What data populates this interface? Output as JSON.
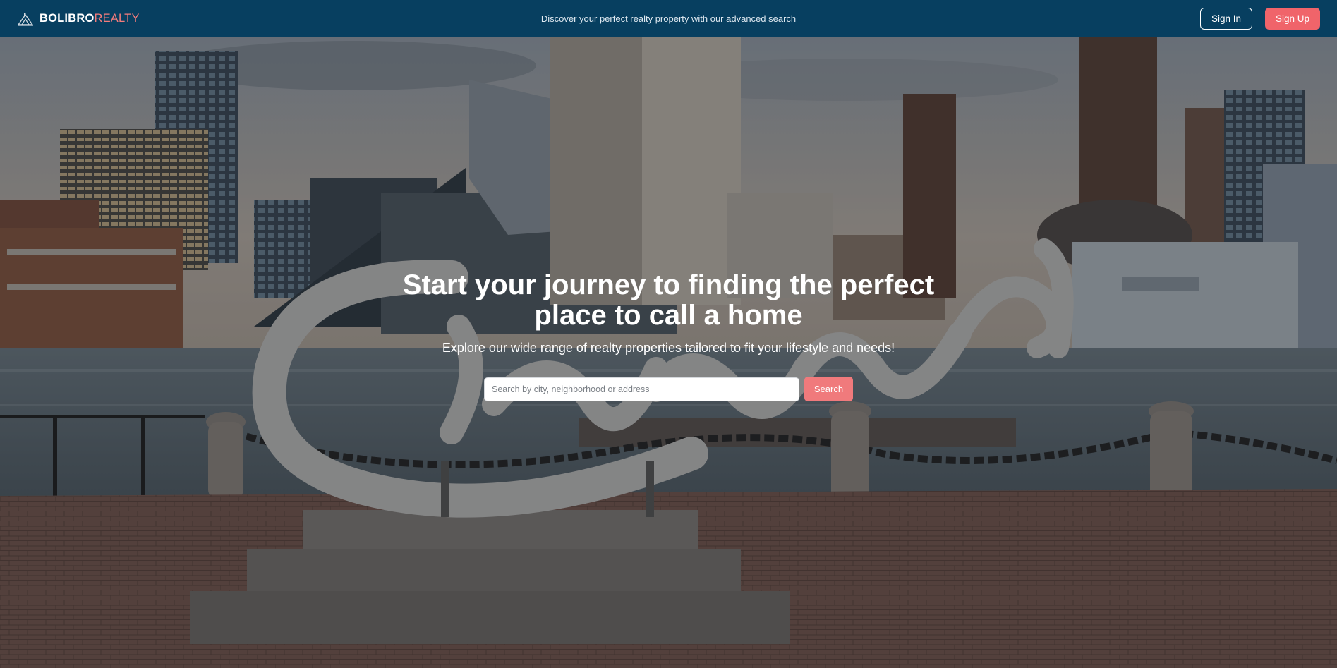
{
  "header": {
    "brand_primary": "BOLIBRO",
    "brand_secondary": "REALTY",
    "tagline": "Discover your perfect realty property with our advanced search",
    "signin_label": "Sign In",
    "signup_label": "Sign Up",
    "logo_icon": "house-logo-icon"
  },
  "hero": {
    "title": "Start your journey to finding the perfect place to call a home",
    "subtitle": "Explore our wide range of realty properties tailored to fit your lifestyle and needs!",
    "search": {
      "placeholder": "Search by city, neighborhood or address",
      "value": "",
      "button_label": "Search"
    },
    "background": "cleveland-sign-waterfront-photo"
  },
  "colors": {
    "navbar": "#073f60",
    "accent": "#f0646a",
    "search_button": "#f07a7c"
  }
}
